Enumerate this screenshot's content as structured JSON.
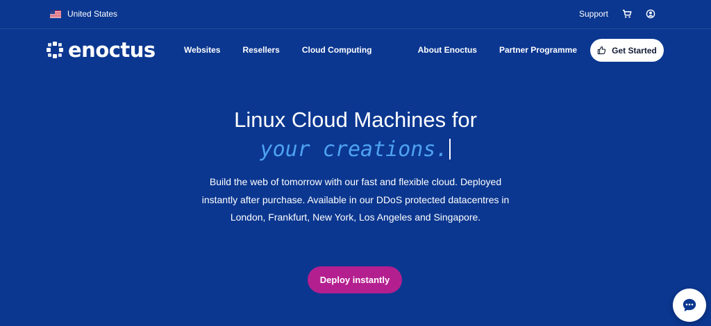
{
  "topbar": {
    "region": "United States",
    "support": "Support",
    "icons": [
      "us-flag-icon",
      "cart-icon",
      "user-account-icon"
    ]
  },
  "nav": {
    "brand": "enoctus",
    "left_links": [
      "Websites",
      "Resellers",
      "Cloud Computing"
    ],
    "right_links": [
      "About Enoctus",
      "Partner Programme"
    ],
    "cta": "Get Started",
    "cta_icon": "thumbs-up-icon"
  },
  "hero": {
    "title": "Linux Cloud Machines for",
    "script": "your creations.",
    "description": "Build the web of tomorrow with our fast and flexible cloud. Deployed instantly after purchase. Available in our DDoS protected datacentres in London, Frankfurt, New York, Los Angeles and Singapore.",
    "button": "Deploy instantly"
  },
  "chat": {
    "icon": "chat-bubble-icon"
  },
  "colors": {
    "background": "#0b3790",
    "accent_script": "#4ea2f2",
    "primary_button": "#b41f8f",
    "cta_bg": "#ffffff"
  }
}
